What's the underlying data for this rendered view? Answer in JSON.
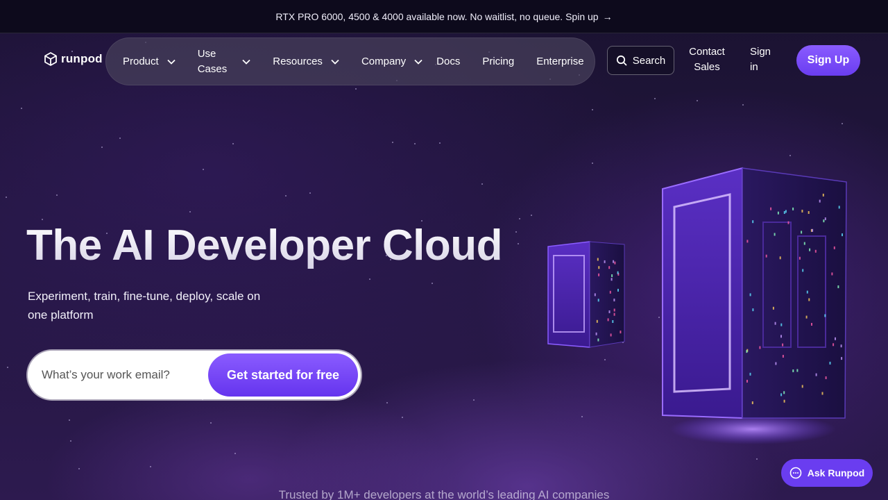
{
  "announcement": {
    "text": "RTX PRO 6000, 4500 & 4000 available now. No waitlist, no queue. Spin up",
    "arrow": "→"
  },
  "brand": {
    "name": "runpod",
    "accent": "#7b4dff"
  },
  "nav": {
    "items": [
      {
        "label": "Product",
        "dropdown": true
      },
      {
        "label_line1": "Use",
        "label_line2": "Cases",
        "dropdown": true
      },
      {
        "label": "Resources",
        "dropdown": true
      },
      {
        "label": "Company",
        "dropdown": true
      },
      {
        "label": "Docs",
        "dropdown": false
      },
      {
        "label": "Pricing",
        "dropdown": false
      },
      {
        "label": "Enterprise",
        "dropdown": false
      }
    ],
    "search_label": "Search",
    "contact_line1": "Contact",
    "contact_line2": "Sales",
    "signin_line1": "Sign",
    "signin_line2": "in",
    "signup_label": "Sign Up"
  },
  "hero": {
    "title": "The AI Developer Cloud",
    "subtitle": "Experiment, train, fine-tune, deploy, scale on one platform",
    "email_placeholder": "What’s your work email?",
    "cta_label": "Get started for free"
  },
  "trusted_text": "Trusted by 1M+ developers at the world’s leading AI companies",
  "ask_label": "Ask Runpod"
}
